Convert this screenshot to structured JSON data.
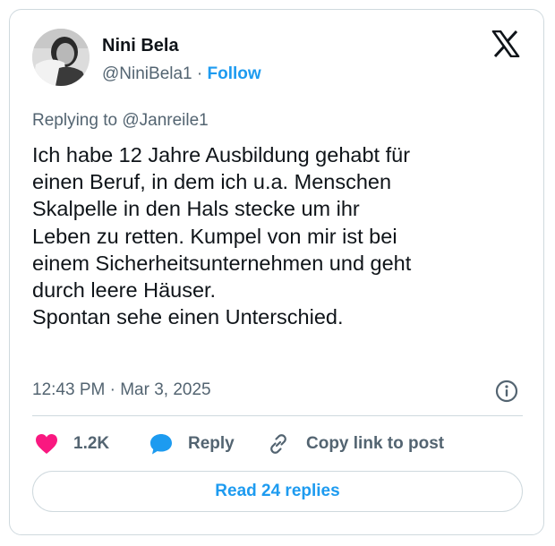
{
  "author": {
    "name": "Nini Bela",
    "handle": "@NiniBela1",
    "separator": "·",
    "follow_label": "Follow"
  },
  "tweet": {
    "replying_to": "Replying to @Janreile1",
    "lines": [
      "Ich habe 12 Jahre Ausbildung gehabt für",
      "einen Beruf, in dem ich u.a. Menschen",
      "Skalpelle in den Hals stecke um ihr",
      "Leben zu retten. Kumpel von mir ist bei",
      "einem Sicherheitsunternehmen und geht",
      "durch leere Häuser.",
      "Spontan sehe einen Unterschied."
    ],
    "timestamp": "12:43 PM · Mar 3, 2025"
  },
  "actions": {
    "like_count": "1.2K",
    "reply_label": "Reply",
    "copy_label": "Copy link to post"
  },
  "read_replies_label": "Read 24 replies",
  "icons": {
    "logo": "x-logo-icon",
    "info": "info-icon",
    "like": "heart-icon",
    "reply": "speech-bubble-icon",
    "copy": "link-icon"
  },
  "colors": {
    "accent": "#1d9bf0",
    "heart": "#f91880",
    "text": "#0f1419",
    "muted": "#536471",
    "border": "#cfd9de"
  }
}
